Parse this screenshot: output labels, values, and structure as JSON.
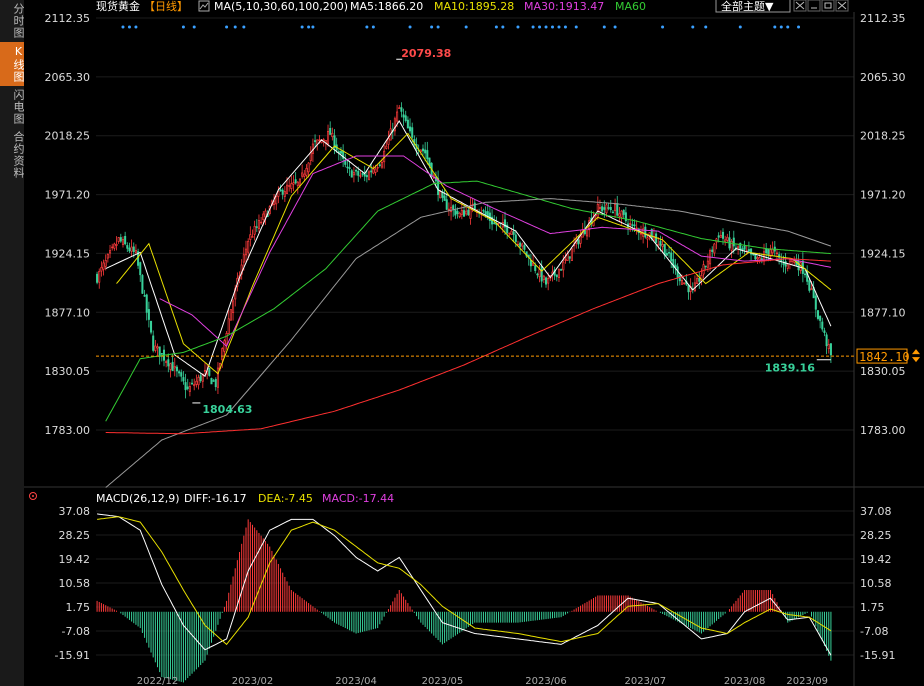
{
  "sidebar": {
    "tabs": [
      {
        "label": "分时图",
        "active": false
      },
      {
        "label": "K线图",
        "active": true
      },
      {
        "label": "闪电图",
        "active": false
      },
      {
        "label": "合约资料",
        "active": false
      }
    ]
  },
  "header": {
    "instrument": "现货黄金",
    "period": "【日线】",
    "ma_params": "MA(5,10,30,60,100,200)",
    "ma5": "MA5:1866.20",
    "ma10": "MA10:1895.28",
    "ma30": "MA30:1913.47",
    "ma60": "MA60",
    "theme_button": "全部主题▼",
    "window_icons": [
      "move-icon",
      "minimize-icon",
      "maximize-icon",
      "close-icon"
    ]
  },
  "macd_header": {
    "params": "MACD(26,12,9)",
    "diff": "DIFF:-16.17",
    "dea": "DEA:-7.45",
    "macd": "MACD:-17.44"
  },
  "colors": {
    "up": "#ff3b3b",
    "down": "#38d19a",
    "ma5": "#ffffff",
    "ma10": "#e8e000",
    "ma30": "#e040e0",
    "ma60": "#33cc33",
    "ma100": "#9a9a9a",
    "ma200": "#ff3030",
    "current_price_line": "#ff9900",
    "macd_diff": "#ffffff",
    "macd_dea": "#e8e000"
  },
  "chart_data": {
    "type": "candlestick",
    "title": "现货黄金 日线",
    "y_ticks": [
      "2112.35",
      "2065.30",
      "2018.25",
      "1971.20",
      "1924.15",
      "1877.10",
      "1830.05",
      "1783.00"
    ],
    "ylim": [
      1783.0,
      2112.35
    ],
    "x_tick_labels": [
      "2022/12",
      "2023/02",
      "2023/04",
      "2023/05",
      "2023/06",
      "2023/07",
      "2023/08",
      "2023/09"
    ],
    "annotations": {
      "high": "2079.38",
      "low": "1804.63",
      "last_low": "1839.16",
      "current_price": "1842.10"
    },
    "current_price": 1842.1,
    "close_anchors": [
      [
        0,
        1905
      ],
      [
        10,
        1935
      ],
      [
        18,
        1923
      ],
      [
        26,
        1850
      ],
      [
        34,
        1836
      ],
      [
        42,
        1815
      ],
      [
        50,
        1828
      ],
      [
        55,
        1820
      ],
      [
        62,
        1880
      ],
      [
        70,
        1935
      ],
      [
        78,
        1955
      ],
      [
        86,
        1975
      ],
      [
        94,
        1980
      ],
      [
        100,
        2010
      ],
      [
        108,
        2020
      ],
      [
        116,
        1990
      ],
      [
        124,
        1985
      ],
      [
        132,
        2000
      ],
      [
        140,
        2040
      ],
      [
        146,
        2015
      ],
      [
        152,
        2005
      ],
      [
        160,
        1965
      ],
      [
        168,
        1955
      ],
      [
        176,
        1962
      ],
      [
        184,
        1948
      ],
      [
        192,
        1943
      ],
      [
        200,
        1920
      ],
      [
        208,
        1900
      ],
      [
        216,
        1915
      ],
      [
        224,
        1938
      ],
      [
        232,
        1960
      ],
      [
        240,
        1960
      ],
      [
        248,
        1945
      ],
      [
        256,
        1940
      ],
      [
        262,
        1930
      ],
      [
        270,
        1905
      ],
      [
        276,
        1893
      ],
      [
        282,
        1915
      ],
      [
        288,
        1940
      ],
      [
        294,
        1930
      ],
      [
        300,
        1925
      ],
      [
        306,
        1918
      ],
      [
        312,
        1928
      ],
      [
        318,
        1915
      ],
      [
        322,
        1920
      ],
      [
        328,
        1910
      ],
      [
        334,
        1875
      ],
      [
        340,
        1842
      ]
    ],
    "ma_anchors": {
      "MA5": [
        [
          4,
          1912
        ],
        [
          20,
          1925
        ],
        [
          36,
          1843
        ],
        [
          50,
          1826
        ],
        [
          66,
          1905
        ],
        [
          84,
          1975
        ],
        [
          104,
          2015
        ],
        [
          124,
          1988
        ],
        [
          140,
          2030
        ],
        [
          158,
          1975
        ],
        [
          174,
          1960
        ],
        [
          194,
          1942
        ],
        [
          210,
          1905
        ],
        [
          232,
          1958
        ],
        [
          256,
          1938
        ],
        [
          276,
          1895
        ],
        [
          296,
          1928
        ],
        [
          316,
          1918
        ],
        [
          328,
          1912
        ],
        [
          340,
          1866
        ]
      ],
      "MA10": [
        [
          9,
          1900
        ],
        [
          24,
          1932
        ],
        [
          40,
          1852
        ],
        [
          56,
          1828
        ],
        [
          72,
          1898
        ],
        [
          90,
          1970
        ],
        [
          110,
          2010
        ],
        [
          128,
          1992
        ],
        [
          144,
          2020
        ],
        [
          164,
          1968
        ],
        [
          184,
          1950
        ],
        [
          206,
          1910
        ],
        [
          232,
          1953
        ],
        [
          262,
          1935
        ],
        [
          282,
          1900
        ],
        [
          302,
          1925
        ],
        [
          322,
          1920
        ],
        [
          340,
          1895
        ]
      ],
      "MA30": [
        [
          29,
          1888
        ],
        [
          44,
          1875
        ],
        [
          60,
          1850
        ],
        [
          80,
          1925
        ],
        [
          100,
          1988
        ],
        [
          120,
          2002
        ],
        [
          142,
          2002
        ],
        [
          162,
          1978
        ],
        [
          184,
          1960
        ],
        [
          210,
          1940
        ],
        [
          234,
          1945
        ],
        [
          260,
          1942
        ],
        [
          280,
          1922
        ],
        [
          300,
          1918
        ],
        [
          320,
          1920
        ],
        [
          340,
          1913
        ]
      ],
      "MA60": [
        [
          4,
          1790
        ],
        [
          20,
          1840
        ],
        [
          40,
          1845
        ],
        [
          60,
          1858
        ],
        [
          82,
          1880
        ],
        [
          106,
          1912
        ],
        [
          130,
          1958
        ],
        [
          156,
          1980
        ],
        [
          176,
          1982
        ],
        [
          196,
          1972
        ],
        [
          220,
          1960
        ],
        [
          250,
          1950
        ],
        [
          280,
          1936
        ],
        [
          310,
          1928
        ],
        [
          340,
          1924
        ]
      ],
      "MA100": [
        [
          4,
          1737
        ],
        [
          30,
          1775
        ],
        [
          60,
          1795
        ],
        [
          90,
          1855
        ],
        [
          120,
          1920
        ],
        [
          150,
          1953
        ],
        [
          180,
          1965
        ],
        [
          210,
          1968
        ],
        [
          240,
          1964
        ],
        [
          270,
          1958
        ],
        [
          300,
          1948
        ],
        [
          320,
          1942
        ],
        [
          340,
          1930
        ]
      ],
      "MA200": [
        [
          4,
          1781
        ],
        [
          40,
          1780
        ],
        [
          76,
          1784
        ],
        [
          110,
          1798
        ],
        [
          140,
          1815
        ],
        [
          170,
          1835
        ],
        [
          200,
          1858
        ],
        [
          230,
          1880
        ],
        [
          260,
          1900
        ],
        [
          290,
          1915
        ],
        [
          320,
          1920
        ],
        [
          340,
          1918
        ]
      ]
    },
    "macd": {
      "y_ticks": [
        "37.08",
        "28.25",
        "19.42",
        "10.58",
        "1.75",
        "-7.08",
        "-15.91"
      ],
      "ylim": [
        -15.91,
        37.08
      ],
      "diff_anchors": [
        [
          0,
          36
        ],
        [
          10,
          35
        ],
        [
          20,
          30
        ],
        [
          30,
          10
        ],
        [
          40,
          -5
        ],
        [
          50,
          -14
        ],
        [
          60,
          -10
        ],
        [
          70,
          15
        ],
        [
          80,
          30
        ],
        [
          90,
          34
        ],
        [
          100,
          34
        ],
        [
          110,
          28
        ],
        [
          120,
          20
        ],
        [
          130,
          15
        ],
        [
          140,
          20
        ],
        [
          150,
          8
        ],
        [
          160,
          -4
        ],
        [
          175,
          -8
        ],
        [
          195,
          -10
        ],
        [
          215,
          -12
        ],
        [
          232,
          -5
        ],
        [
          246,
          5
        ],
        [
          260,
          3
        ],
        [
          280,
          -10
        ],
        [
          292,
          -8
        ],
        [
          300,
          0
        ],
        [
          312,
          5
        ],
        [
          320,
          -3
        ],
        [
          330,
          -2
        ],
        [
          340,
          -16
        ]
      ],
      "dea_anchors": [
        [
          0,
          34
        ],
        [
          10,
          35
        ],
        [
          20,
          33
        ],
        [
          30,
          22
        ],
        [
          40,
          8
        ],
        [
          50,
          -5
        ],
        [
          60,
          -12
        ],
        [
          70,
          -2
        ],
        [
          80,
          18
        ],
        [
          90,
          30
        ],
        [
          100,
          33
        ],
        [
          110,
          30
        ],
        [
          120,
          24
        ],
        [
          130,
          18
        ],
        [
          140,
          16
        ],
        [
          150,
          10
        ],
        [
          160,
          2
        ],
        [
          175,
          -6
        ],
        [
          195,
          -8
        ],
        [
          215,
          -11
        ],
        [
          232,
          -8
        ],
        [
          246,
          2
        ],
        [
          260,
          3
        ],
        [
          280,
          -6
        ],
        [
          292,
          -8
        ],
        [
          300,
          -4
        ],
        [
          312,
          1
        ],
        [
          320,
          -1
        ],
        [
          330,
          -2
        ],
        [
          340,
          -7
        ]
      ]
    }
  }
}
